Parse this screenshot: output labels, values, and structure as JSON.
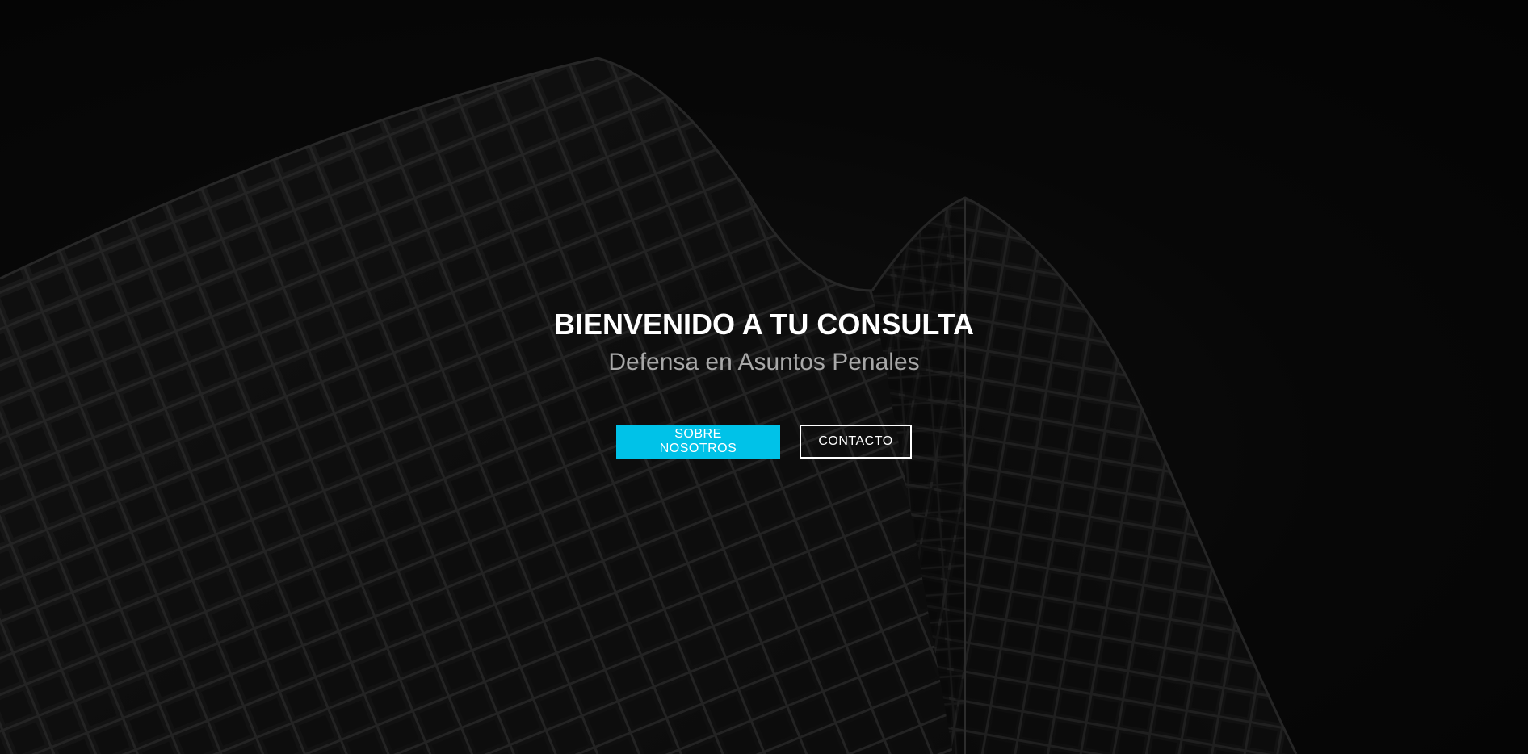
{
  "hero": {
    "title": "BIENVENIDO A TU CONSULTA",
    "subtitle": "Defensa en Asuntos Penales",
    "buttons": {
      "about_label": "SOBRE NOSOTROS",
      "contact_label": "CONTACTO"
    }
  },
  "colors": {
    "accent": "#00c2e8",
    "background": "#0a0a0a",
    "title": "#ffffff",
    "subtitle": "#a8a8a8"
  },
  "icons": {
    "background_image": "building-facade-image"
  }
}
